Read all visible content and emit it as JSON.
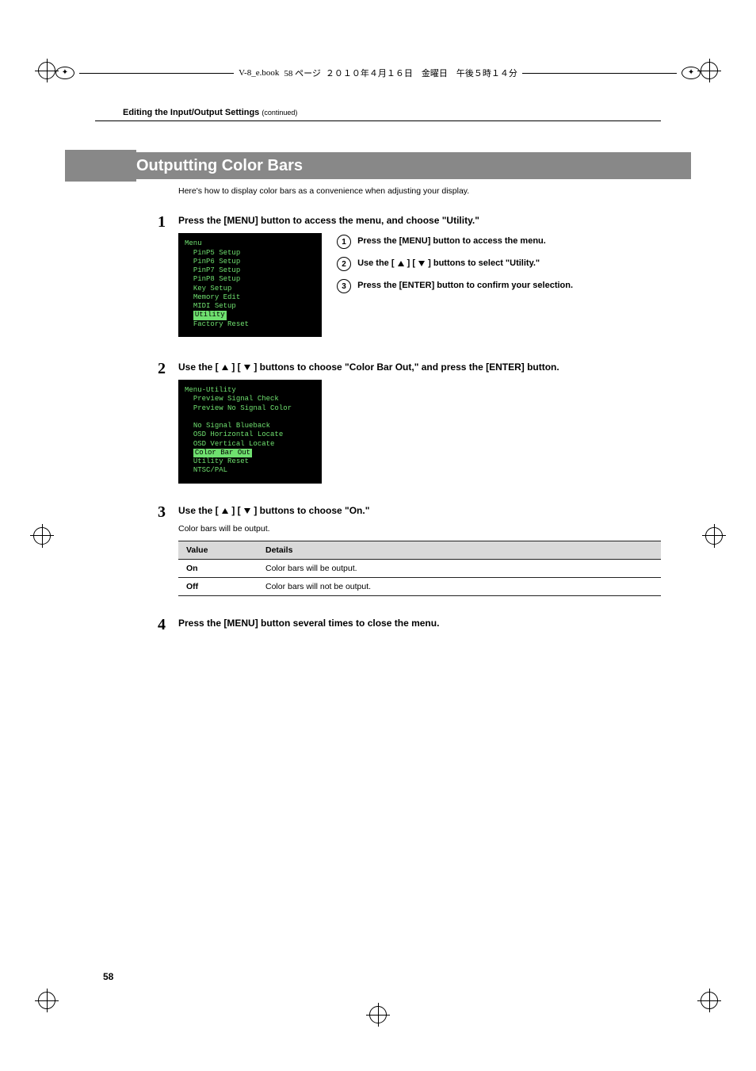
{
  "header_strip": {
    "file": "V-8_e.book",
    "page_jp": "58 ページ",
    "date_jp": "２０１０年４月１６日　金曜日　午後５時１４分"
  },
  "running_header": {
    "title": "Editing the Input/Output Settings",
    "cont": "(continued)"
  },
  "section_title": "Outputting Color Bars",
  "lead": "Here's how to display color bars as a convenience when adjusting your display.",
  "steps": {
    "s1": {
      "num": "1",
      "title": "Press the [MENU] button to access the menu, and choose \"Utility.\"",
      "screen": {
        "title": "Menu",
        "lines": [
          "PinP5 Setup",
          "PinP6 Setup",
          "PinP7 Setup",
          "PinP8 Setup",
          "Key Setup",
          "Memory Edit",
          "MIDI Setup"
        ],
        "highlight": "Utility",
        "after": [
          "Factory Reset"
        ]
      },
      "subs": {
        "a": {
          "n": "1",
          "t": "Press the [MENU] button to access the menu."
        },
        "b": {
          "n": "2",
          "t_pre": "Use the [ ",
          "t_mid": " ] [ ",
          "t_post": " ] buttons to select \"Utility.\""
        },
        "c": {
          "n": "3",
          "t": "Press the [ENTER] button to confirm your selection."
        }
      }
    },
    "s2": {
      "num": "2",
      "title_pre": "Use the [ ",
      "title_mid": " ] [ ",
      "title_post": " ] buttons to choose \"Color Bar Out,\" and press the [ENTER] button.",
      "screen": {
        "title": "Menu-Utility",
        "lines": [
          "Preview Signal Check",
          "Preview No Signal Color"
        ],
        "lines2": [
          "No Signal Blueback",
          "OSD Horizontal Locate",
          "OSD Vertical Locate"
        ],
        "highlight": "Color Bar Out",
        "after": [
          "Utility Reset",
          "NTSC/PAL"
        ]
      }
    },
    "s3": {
      "num": "3",
      "title_pre": "Use the [ ",
      "title_mid": " ] [ ",
      "title_post": " ] buttons to choose \"On.\"",
      "sub": "Color bars will be output.",
      "table": {
        "h1": "Value",
        "h2": "Details",
        "rows": [
          {
            "k": "On",
            "v": "Color bars will be output."
          },
          {
            "k": "Off",
            "v": "Color bars will not be output."
          }
        ]
      }
    },
    "s4": {
      "num": "4",
      "title": "Press the [MENU] button several times to close the menu."
    }
  },
  "page_number": "58"
}
